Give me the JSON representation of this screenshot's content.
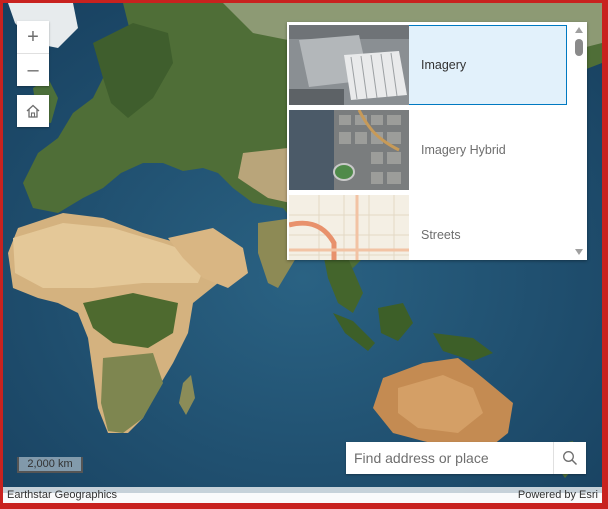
{
  "map": {
    "zoom_in_label": "+",
    "zoom_out_label": "–",
    "scale_label": "2,000 km",
    "attribution": "Earthstar Geographics",
    "powered_by": "Powered by Esri"
  },
  "basemap_gallery": {
    "items": [
      {
        "label": "Imagery",
        "selected": true
      },
      {
        "label": "Imagery Hybrid",
        "selected": false
      },
      {
        "label": "Streets",
        "selected": false
      }
    ]
  },
  "search": {
    "placeholder": "Find address or place",
    "value": ""
  },
  "icons": {
    "home": "home-icon",
    "search": "search-icon"
  },
  "colors": {
    "frame": "#c8221f",
    "accent": "#0079c1",
    "selected_bg": "#e2f1fb",
    "ocean": "#1f4d6e"
  }
}
